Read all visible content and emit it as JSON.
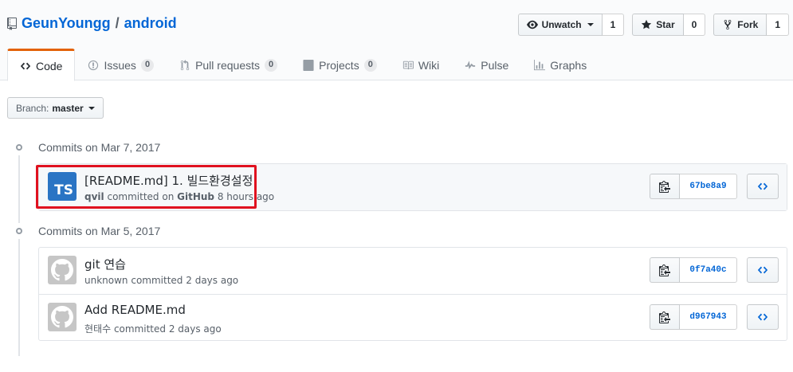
{
  "repo": {
    "owner": "GeunYoungg",
    "separator": "/",
    "name": "android"
  },
  "actions": {
    "watch": {
      "label": "Unwatch",
      "count": "1"
    },
    "star": {
      "label": "Star",
      "count": "0"
    },
    "fork": {
      "label": "Fork",
      "count": "1"
    }
  },
  "nav": [
    {
      "label": "Code",
      "counter": null,
      "icon": "code-icon"
    },
    {
      "label": "Issues",
      "counter": "0",
      "icon": "issue-icon"
    },
    {
      "label": "Pull requests",
      "counter": "0",
      "icon": "pull-request-icon"
    },
    {
      "label": "Projects",
      "counter": "0",
      "icon": "project-icon"
    },
    {
      "label": "Wiki",
      "counter": null,
      "icon": "book-icon"
    },
    {
      "label": "Pulse",
      "counter": null,
      "icon": "pulse-icon"
    },
    {
      "label": "Graphs",
      "counter": null,
      "icon": "graph-icon"
    }
  ],
  "branch": {
    "label": "Branch:",
    "value": "master"
  },
  "groups": [
    {
      "title": "Commits on Mar 7, 2017",
      "commits": [
        {
          "title": "[README.md] 1. 빌드환경설정",
          "author": "qvil",
          "action": "committed on",
          "via": "GitHub",
          "time": "8 hours ago",
          "sha": "67be8a9",
          "avatar": "TS"
        }
      ]
    },
    {
      "title": "Commits on Mar 5, 2017",
      "commits": [
        {
          "title": "git 연습",
          "author": "unknown",
          "action": "committed",
          "time": "2 days ago",
          "sha": "0f7a40c"
        },
        {
          "title": "Add README.md",
          "author": "현태수",
          "action": "committed",
          "time": "2 days ago",
          "sha": "d967943"
        }
      ]
    }
  ],
  "colors": {
    "link": "#0366d6",
    "highlight": "#e0111f",
    "tab_accent": "#e36209",
    "ts_avatar": "#2a74c4"
  }
}
